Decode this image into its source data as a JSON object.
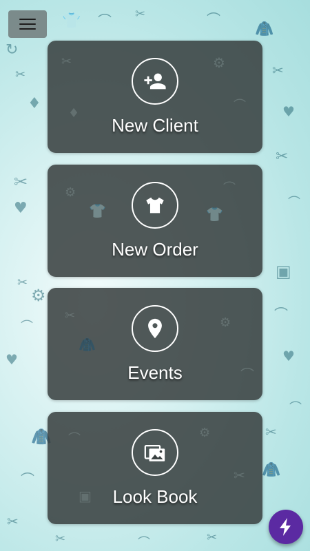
{
  "menu": {
    "icon": "menu-icon"
  },
  "tiles": [
    {
      "label": "New Client",
      "icon": "add-person-icon"
    },
    {
      "label": "New Order",
      "icon": "tshirt-icon"
    },
    {
      "label": "Events",
      "icon": "location-pin-icon"
    },
    {
      "label": "Look Book",
      "icon": "photo-album-icon"
    }
  ],
  "fab": {
    "icon": "lightning-bolt-icon",
    "color": "#5b2aa2"
  },
  "colors": {
    "tile_background": "#373e3e",
    "accent_pattern": "#2f6f7c"
  }
}
